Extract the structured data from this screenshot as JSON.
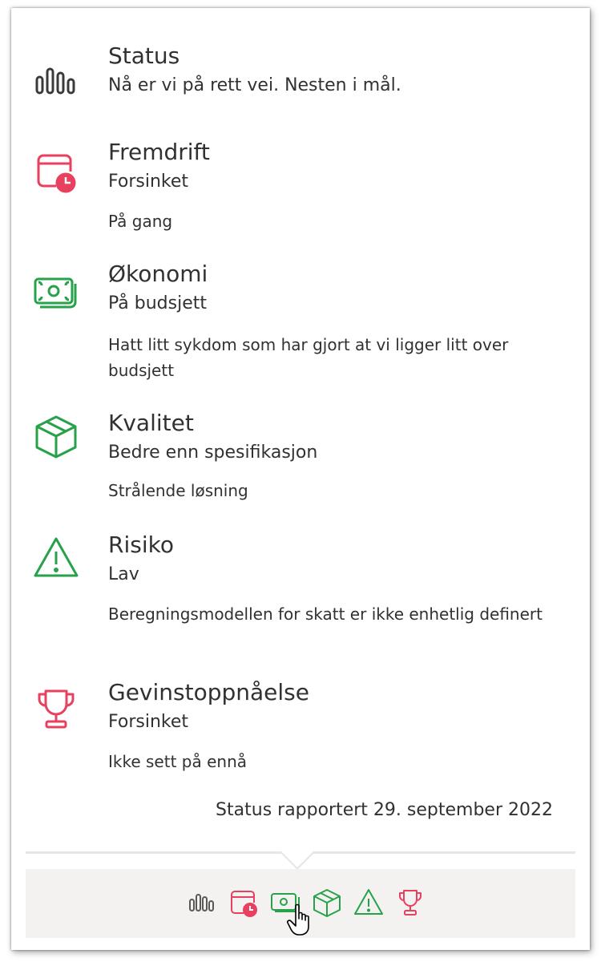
{
  "colors": {
    "neutral": "#3b3a39",
    "red": "#e8405f",
    "green": "#27a24a"
  },
  "items": [
    {
      "title": "Status",
      "subtitle": "Nå er vi på rett vei. Nesten i mål.",
      "comment": "",
      "icon": "bar-chart-icon",
      "status_color": "#3b3a39"
    },
    {
      "title": "Fremdrift",
      "subtitle": "Forsinket",
      "comment": "På gang",
      "icon": "calendar-clock-icon",
      "status_color": "#e8405f"
    },
    {
      "title": "Økonomi",
      "subtitle": "På budsjett",
      "comment": "Hatt litt sykdom som har gjort at vi ligger litt over budsjett",
      "icon": "money-icon",
      "status_color": "#27a24a"
    },
    {
      "title": "Kvalitet",
      "subtitle": "Bedre enn spesifikasjon",
      "comment": "Strålende løsning",
      "icon": "box-icon",
      "status_color": "#27a24a"
    },
    {
      "title": "Risiko",
      "subtitle": "Lav",
      "comment": "Beregningsmodellen for skatt er ikke enhetlig definert",
      "icon": "warning-icon",
      "status_color": "#27a24a"
    },
    {
      "title": "Gevinstoppnåelse",
      "subtitle": "Forsinket",
      "comment": "Ikke sett på ennå",
      "icon": "trophy-icon",
      "status_color": "#e8405f"
    }
  ],
  "footer": {
    "reported": "Status rapportert 29. september 2022"
  },
  "bottom_nav": [
    {
      "icon": "bar-chart-icon",
      "color": "#5a5958"
    },
    {
      "icon": "calendar-clock-icon",
      "color": "#e8405f"
    },
    {
      "icon": "money-icon",
      "color": "#27a24a"
    },
    {
      "icon": "box-icon",
      "color": "#27a24a"
    },
    {
      "icon": "warning-icon",
      "color": "#27a24a"
    },
    {
      "icon": "trophy-icon",
      "color": "#e8405f"
    }
  ]
}
